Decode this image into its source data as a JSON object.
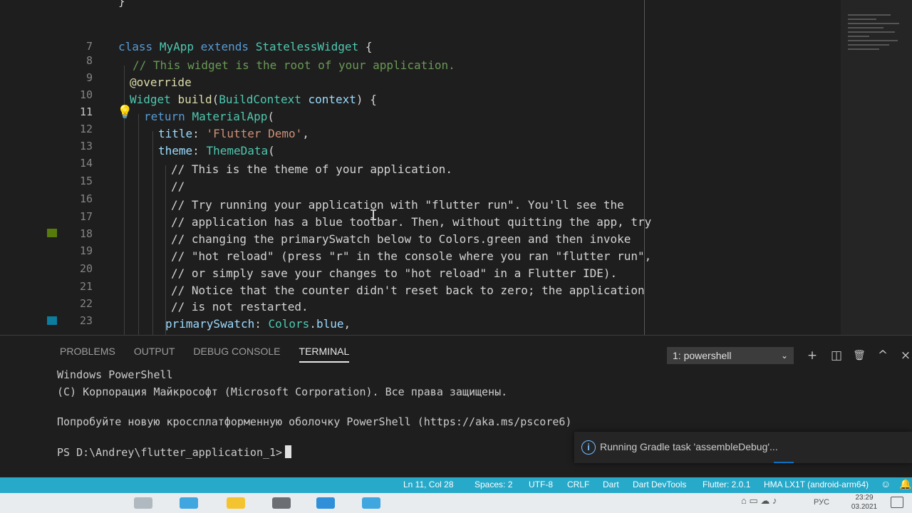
{
  "editor": {
    "lines": [
      {
        "num": "",
        "text": "}"
      },
      {
        "num": "7",
        "text": ""
      },
      {
        "num": "8",
        "text": "class MyApp extends StatelessWidget {"
      },
      {
        "num": "9",
        "text": "// This widget is the root of your application."
      },
      {
        "num": "10",
        "text": "@override"
      },
      {
        "num": "11",
        "text": "Widget build(BuildContext context) {"
      },
      {
        "num": "12",
        "text": "return MaterialApp("
      },
      {
        "num": "13",
        "text": "title: 'Flutter Demo',"
      },
      {
        "num": "14",
        "text": "theme: ThemeData("
      },
      {
        "num": "15",
        "text": "// This is the theme of your application."
      },
      {
        "num": "16",
        "text": "//"
      },
      {
        "num": "17",
        "text": "// Try running your application with \"flutter run\". You'll see the"
      },
      {
        "num": "18",
        "text": "// application has a blue toolbar. Then, without quitting the app, try"
      },
      {
        "num": "19",
        "text": "// changing the primarySwatch below to Colors.green and then invoke"
      },
      {
        "num": "20",
        "text": "// \"hot reload\" (press \"r\" in the console where you ran \"flutter run\","
      },
      {
        "num": "21",
        "text": "// or simply save your changes to \"hot reload\" in a Flutter IDE)."
      },
      {
        "num": "22",
        "text": "// Notice that the counter didn't reset back to zero; the application"
      },
      {
        "num": "23",
        "text": "// is not restarted."
      },
      {
        "num": "",
        "text": "primarySwatch: Colors.blue,"
      }
    ],
    "active_line": "11",
    "lightbulb_icon": "lightbulb-icon",
    "text_cursor_icon": "i-beam-cursor-icon"
  },
  "panel": {
    "tabs": [
      {
        "label": "PROBLEMS",
        "active": false
      },
      {
        "label": "OUTPUT",
        "active": false
      },
      {
        "label": "DEBUG CONSOLE",
        "active": false
      },
      {
        "label": "TERMINAL",
        "active": true
      }
    ],
    "terminal_select": "1: powershell",
    "actions": {
      "new": "+",
      "split": "◫",
      "kill": "🗑",
      "maximize": "^",
      "close": "×"
    }
  },
  "terminal": {
    "lines": [
      "Windows PowerShell",
      "(C) Корпорация Майкрософт (Microsoft Corporation). Все права защищены.",
      "",
      "Попробуйте новую кроссплатформенную оболочку PowerShell (https://aka.ms/pscore6)",
      ""
    ],
    "prompt": "PS D:\\Andrey\\flutter_application_1>"
  },
  "notification": {
    "icon": "info-icon",
    "icon_glyph": "i",
    "text": "Running Gradle task 'assembleDebug'..."
  },
  "statusbar": {
    "items": [
      "Ln 11, Col 28",
      "Spaces: 2",
      "UTF-8",
      "CRLF",
      "Dart",
      "Dart DevTools",
      "Flutter: 2.0.1",
      "HMA LX1T (android-arm64)"
    ],
    "color": "#27a9c9"
  },
  "taskbar": {
    "lang": "РУС",
    "time": "23:29",
    "date": "03.2021"
  }
}
